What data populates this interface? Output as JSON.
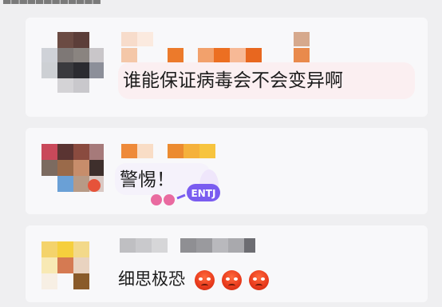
{
  "comments": [
    {
      "text": "谁能保证病毒会不会变异啊"
    },
    {
      "text": "警惕！",
      "sticker_label": "ENTJ"
    },
    {
      "text": "细思极恐",
      "reactions": [
        "angry-face-emoji",
        "angry-face-emoji",
        "angry-face-emoji"
      ]
    }
  ],
  "colors": {
    "background": "#efeff1",
    "card": "#f8f8fa",
    "bubble": "#fbeff1",
    "emoji": "#e83a1c",
    "sticker_purple": "#7a5cf0"
  }
}
